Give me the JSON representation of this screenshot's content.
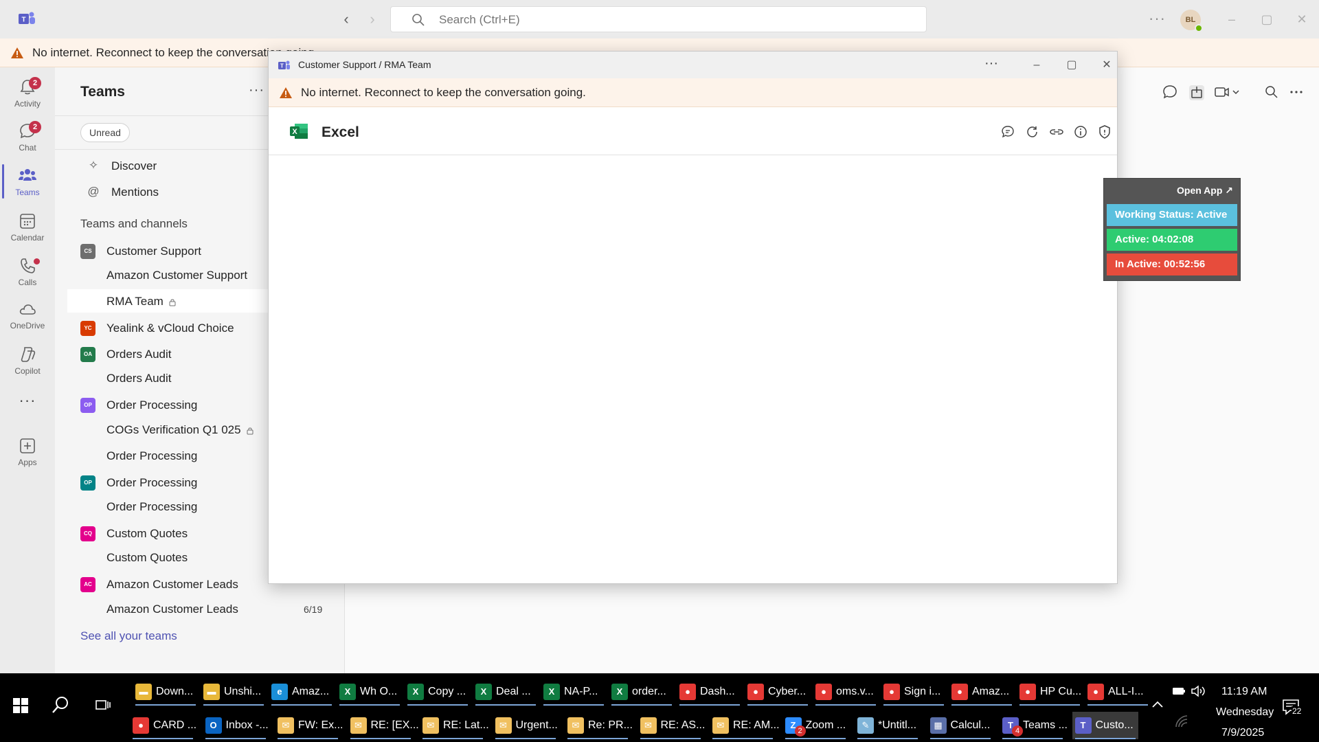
{
  "titlebar": {
    "search_placeholder": "Search (Ctrl+E)",
    "more": "···",
    "avatar_initials": "BL"
  },
  "offline_banner": {
    "text": "No internet. Reconnect to keep the conversation going."
  },
  "rail": [
    {
      "label": "Activity",
      "icon": "bell-icon",
      "badge": "2"
    },
    {
      "label": "Chat",
      "icon": "chat-icon",
      "badge": "2"
    },
    {
      "label": "Teams",
      "icon": "teams-icon",
      "active": true
    },
    {
      "label": "Calendar",
      "icon": "calendar-icon"
    },
    {
      "label": "Calls",
      "icon": "phone-icon",
      "dot": true
    },
    {
      "label": "OneDrive",
      "icon": "cloud-icon"
    },
    {
      "label": "Copilot",
      "icon": "copilot-icon"
    },
    {
      "label": "···",
      "icon": "more-icon"
    },
    {
      "label": "Apps",
      "icon": "add-app-icon"
    }
  ],
  "panel": {
    "title": "Teams",
    "more": "···",
    "filter_chip": "Unread",
    "discover": "Discover",
    "mentions": "Mentions",
    "section_head": "Teams and channels",
    "teams": [
      {
        "name": "Customer Support",
        "abbr": "CS",
        "color": "#6e6e6e"
      },
      {
        "name": "Yealink & vCloud Choice",
        "abbr": "YC",
        "color": "#d83b01"
      },
      {
        "name": "Orders Audit",
        "abbr": "OA",
        "color": "#237b4b"
      },
      {
        "name": "Order Processing",
        "abbr": "OP",
        "color": "#8c5cf0"
      },
      {
        "name": "Order Processing",
        "abbr": "OP",
        "color": "#038387"
      },
      {
        "name": "Custom Quotes",
        "abbr": "CQ",
        "color": "#e3008c"
      },
      {
        "name": "Amazon Customer Leads",
        "abbr": "AC",
        "color": "#e3008c"
      }
    ],
    "channels": [
      {
        "name": "Amazon Customer Support"
      },
      {
        "name": "RMA Team",
        "selected": true
      },
      {
        "name": "Orders Audit"
      },
      {
        "name": "COGs Verification Q1 025"
      },
      {
        "name": "Order Processing"
      },
      {
        "name": "Order Processing"
      },
      {
        "name": "Custom Quotes"
      },
      {
        "name": "Amazon Customer Leads",
        "count": "6/19"
      }
    ],
    "see_all": "See all your teams"
  },
  "popout": {
    "title": "Customer Support / RMA Team",
    "more": "···",
    "banner": "No internet. Reconnect to keep the conversation going.",
    "app_name": "Excel"
  },
  "widget": {
    "open_app": "Open App ↗",
    "working_status": "Working Status: Active",
    "active": "Active: 04:02:08",
    "inactive": "In Active: 00:52:56",
    "colors": {
      "status": "#5bc0de",
      "active": "#2ecc71",
      "inactive": "#e74c3c"
    }
  },
  "taskbar": {
    "row1": [
      {
        "label": "Down...",
        "icon": "folder-icon"
      },
      {
        "label": "Unshi...",
        "icon": "folder-icon"
      },
      {
        "label": "Amaz...",
        "icon": "edge-icon"
      },
      {
        "label": "Wh O...",
        "icon": "excel-icon"
      },
      {
        "label": "Copy ...",
        "icon": "excel-icon"
      },
      {
        "label": "Deal ...",
        "icon": "excel-icon"
      },
      {
        "label": "NA-P...",
        "icon": "excel-icon"
      },
      {
        "label": "order...",
        "icon": "excel-icon"
      },
      {
        "label": "Dash...",
        "icon": "chrome-icon"
      },
      {
        "label": "Cyber...",
        "icon": "chrome-icon"
      },
      {
        "label": "oms.v...",
        "icon": "chrome-icon"
      },
      {
        "label": "Sign i...",
        "icon": "chrome-icon"
      },
      {
        "label": "Amaz...",
        "icon": "chrome-icon"
      },
      {
        "label": "HP Cu...",
        "icon": "chrome-icon"
      },
      {
        "label": "ALL-I...",
        "icon": "chrome-icon"
      }
    ],
    "row2": [
      {
        "label": "CARD ...",
        "icon": "chrome-icon"
      },
      {
        "label": "Inbox -...",
        "icon": "outlook-icon"
      },
      {
        "label": "FW: Ex...",
        "icon": "mail-icon"
      },
      {
        "label": "RE: [EX...",
        "icon": "mail-icon"
      },
      {
        "label": "RE: Lat...",
        "icon": "mail-icon"
      },
      {
        "label": "Urgent...",
        "icon": "mail-icon"
      },
      {
        "label": "Re: PR...",
        "icon": "mail-icon"
      },
      {
        "label": "RE: AS...",
        "icon": "mail-icon"
      },
      {
        "label": "RE: AM...",
        "icon": "mail-icon"
      },
      {
        "label": "Zoom ...",
        "icon": "zoom-icon",
        "badge": "2"
      },
      {
        "label": "*Untitl...",
        "icon": "notepad-icon"
      },
      {
        "label": "Calcul...",
        "icon": "calculator-icon"
      },
      {
        "label": "Teams ...",
        "icon": "teams-icon",
        "badge": "4"
      },
      {
        "label": "Custo...",
        "icon": "teams-icon",
        "active": true
      }
    ],
    "time": "11:19 AM",
    "day": "Wednesday",
    "date": "7/9/2025",
    "notifications": "22"
  }
}
